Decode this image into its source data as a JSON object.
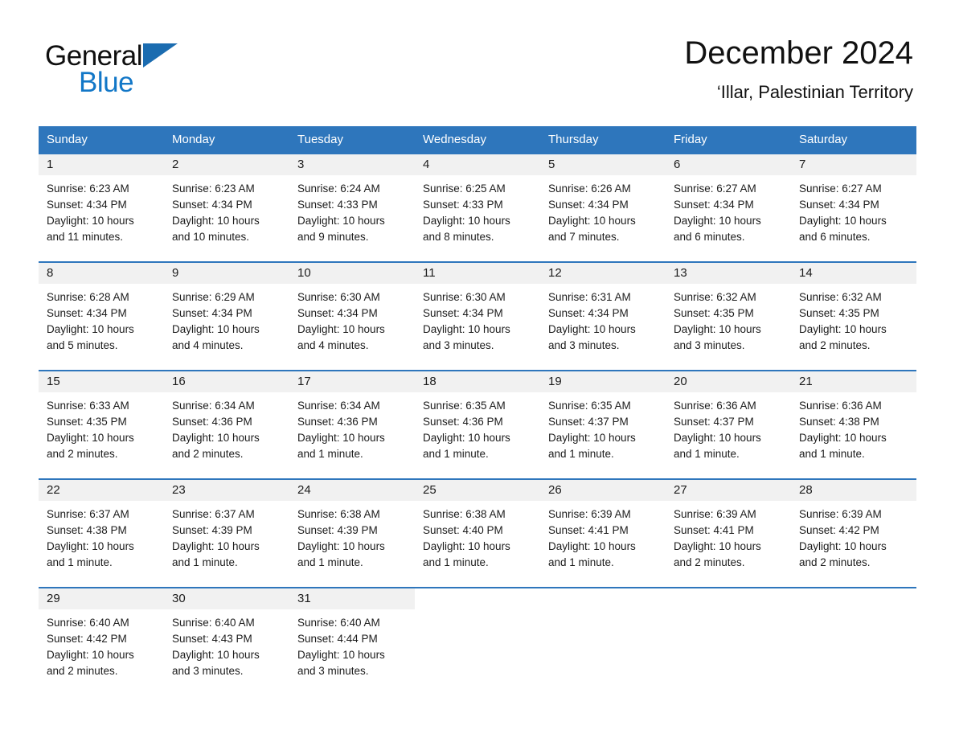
{
  "brand": {
    "word1": "General",
    "word2": "Blue",
    "triangle_color": "#1b6cb0",
    "blue_text_color": "#1277c7"
  },
  "header": {
    "title": "December 2024",
    "subtitle": "‘Illar, Palestinian Territory"
  },
  "theme": {
    "accent": "#2e76bc",
    "daynum_bg": "#f1f1f1",
    "page_bg": "#ffffff",
    "text": "#1c1c1c"
  },
  "weekday_headers": [
    "Sunday",
    "Monday",
    "Tuesday",
    "Wednesday",
    "Thursday",
    "Friday",
    "Saturday"
  ],
  "weeks": [
    [
      {
        "day": "1",
        "sunrise": "Sunrise: 6:23 AM",
        "sunset": "Sunset: 4:34 PM",
        "daylight1": "Daylight: 10 hours",
        "daylight2": "and 11 minutes."
      },
      {
        "day": "2",
        "sunrise": "Sunrise: 6:23 AM",
        "sunset": "Sunset: 4:34 PM",
        "daylight1": "Daylight: 10 hours",
        "daylight2": "and 10 minutes."
      },
      {
        "day": "3",
        "sunrise": "Sunrise: 6:24 AM",
        "sunset": "Sunset: 4:33 PM",
        "daylight1": "Daylight: 10 hours",
        "daylight2": "and 9 minutes."
      },
      {
        "day": "4",
        "sunrise": "Sunrise: 6:25 AM",
        "sunset": "Sunset: 4:33 PM",
        "daylight1": "Daylight: 10 hours",
        "daylight2": "and 8 minutes."
      },
      {
        "day": "5",
        "sunrise": "Sunrise: 6:26 AM",
        "sunset": "Sunset: 4:34 PM",
        "daylight1": "Daylight: 10 hours",
        "daylight2": "and 7 minutes."
      },
      {
        "day": "6",
        "sunrise": "Sunrise: 6:27 AM",
        "sunset": "Sunset: 4:34 PM",
        "daylight1": "Daylight: 10 hours",
        "daylight2": "and 6 minutes."
      },
      {
        "day": "7",
        "sunrise": "Sunrise: 6:27 AM",
        "sunset": "Sunset: 4:34 PM",
        "daylight1": "Daylight: 10 hours",
        "daylight2": "and 6 minutes."
      }
    ],
    [
      {
        "day": "8",
        "sunrise": "Sunrise: 6:28 AM",
        "sunset": "Sunset: 4:34 PM",
        "daylight1": "Daylight: 10 hours",
        "daylight2": "and 5 minutes."
      },
      {
        "day": "9",
        "sunrise": "Sunrise: 6:29 AM",
        "sunset": "Sunset: 4:34 PM",
        "daylight1": "Daylight: 10 hours",
        "daylight2": "and 4 minutes."
      },
      {
        "day": "10",
        "sunrise": "Sunrise: 6:30 AM",
        "sunset": "Sunset: 4:34 PM",
        "daylight1": "Daylight: 10 hours",
        "daylight2": "and 4 minutes."
      },
      {
        "day": "11",
        "sunrise": "Sunrise: 6:30 AM",
        "sunset": "Sunset: 4:34 PM",
        "daylight1": "Daylight: 10 hours",
        "daylight2": "and 3 minutes."
      },
      {
        "day": "12",
        "sunrise": "Sunrise: 6:31 AM",
        "sunset": "Sunset: 4:34 PM",
        "daylight1": "Daylight: 10 hours",
        "daylight2": "and 3 minutes."
      },
      {
        "day": "13",
        "sunrise": "Sunrise: 6:32 AM",
        "sunset": "Sunset: 4:35 PM",
        "daylight1": "Daylight: 10 hours",
        "daylight2": "and 3 minutes."
      },
      {
        "day": "14",
        "sunrise": "Sunrise: 6:32 AM",
        "sunset": "Sunset: 4:35 PM",
        "daylight1": "Daylight: 10 hours",
        "daylight2": "and 2 minutes."
      }
    ],
    [
      {
        "day": "15",
        "sunrise": "Sunrise: 6:33 AM",
        "sunset": "Sunset: 4:35 PM",
        "daylight1": "Daylight: 10 hours",
        "daylight2": "and 2 minutes."
      },
      {
        "day": "16",
        "sunrise": "Sunrise: 6:34 AM",
        "sunset": "Sunset: 4:36 PM",
        "daylight1": "Daylight: 10 hours",
        "daylight2": "and 2 minutes."
      },
      {
        "day": "17",
        "sunrise": "Sunrise: 6:34 AM",
        "sunset": "Sunset: 4:36 PM",
        "daylight1": "Daylight: 10 hours",
        "daylight2": "and 1 minute."
      },
      {
        "day": "18",
        "sunrise": "Sunrise: 6:35 AM",
        "sunset": "Sunset: 4:36 PM",
        "daylight1": "Daylight: 10 hours",
        "daylight2": "and 1 minute."
      },
      {
        "day": "19",
        "sunrise": "Sunrise: 6:35 AM",
        "sunset": "Sunset: 4:37 PM",
        "daylight1": "Daylight: 10 hours",
        "daylight2": "and 1 minute."
      },
      {
        "day": "20",
        "sunrise": "Sunrise: 6:36 AM",
        "sunset": "Sunset: 4:37 PM",
        "daylight1": "Daylight: 10 hours",
        "daylight2": "and 1 minute."
      },
      {
        "day": "21",
        "sunrise": "Sunrise: 6:36 AM",
        "sunset": "Sunset: 4:38 PM",
        "daylight1": "Daylight: 10 hours",
        "daylight2": "and 1 minute."
      }
    ],
    [
      {
        "day": "22",
        "sunrise": "Sunrise: 6:37 AM",
        "sunset": "Sunset: 4:38 PM",
        "daylight1": "Daylight: 10 hours",
        "daylight2": "and 1 minute."
      },
      {
        "day": "23",
        "sunrise": "Sunrise: 6:37 AM",
        "sunset": "Sunset: 4:39 PM",
        "daylight1": "Daylight: 10 hours",
        "daylight2": "and 1 minute."
      },
      {
        "day": "24",
        "sunrise": "Sunrise: 6:38 AM",
        "sunset": "Sunset: 4:39 PM",
        "daylight1": "Daylight: 10 hours",
        "daylight2": "and 1 minute."
      },
      {
        "day": "25",
        "sunrise": "Sunrise: 6:38 AM",
        "sunset": "Sunset: 4:40 PM",
        "daylight1": "Daylight: 10 hours",
        "daylight2": "and 1 minute."
      },
      {
        "day": "26",
        "sunrise": "Sunrise: 6:39 AM",
        "sunset": "Sunset: 4:41 PM",
        "daylight1": "Daylight: 10 hours",
        "daylight2": "and 1 minute."
      },
      {
        "day": "27",
        "sunrise": "Sunrise: 6:39 AM",
        "sunset": "Sunset: 4:41 PM",
        "daylight1": "Daylight: 10 hours",
        "daylight2": "and 2 minutes."
      },
      {
        "day": "28",
        "sunrise": "Sunrise: 6:39 AM",
        "sunset": "Sunset: 4:42 PM",
        "daylight1": "Daylight: 10 hours",
        "daylight2": "and 2 minutes."
      }
    ],
    [
      {
        "day": "29",
        "sunrise": "Sunrise: 6:40 AM",
        "sunset": "Sunset: 4:42 PM",
        "daylight1": "Daylight: 10 hours",
        "daylight2": "and 2 minutes."
      },
      {
        "day": "30",
        "sunrise": "Sunrise: 6:40 AM",
        "sunset": "Sunset: 4:43 PM",
        "daylight1": "Daylight: 10 hours",
        "daylight2": "and 3 minutes."
      },
      {
        "day": "31",
        "sunrise": "Sunrise: 6:40 AM",
        "sunset": "Sunset: 4:44 PM",
        "daylight1": "Daylight: 10 hours",
        "daylight2": "and 3 minutes."
      },
      null,
      null,
      null,
      null
    ]
  ]
}
